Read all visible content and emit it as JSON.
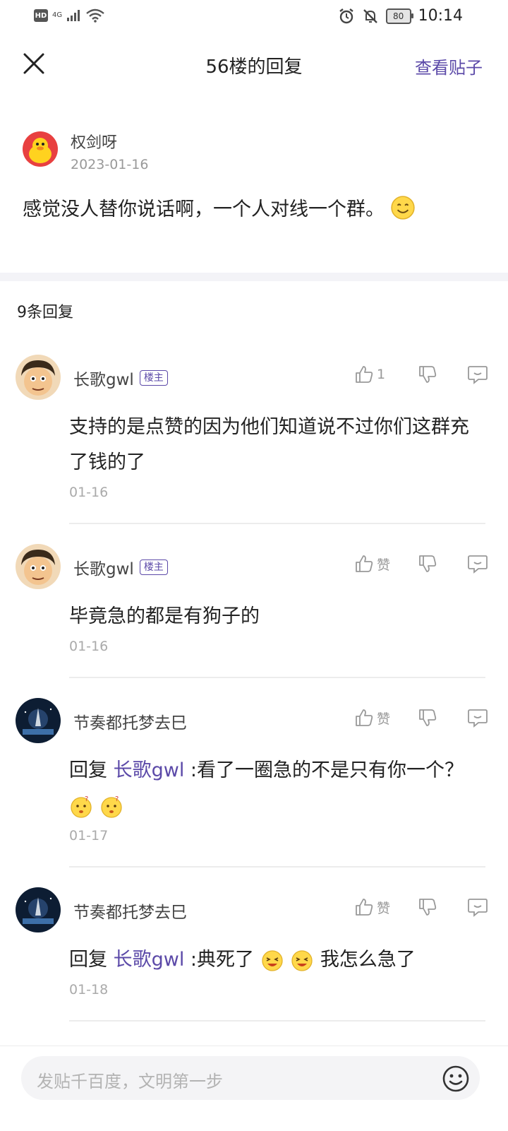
{
  "status_bar": {
    "hd": "HD",
    "network": "4G",
    "battery": "80",
    "time": "10:14"
  },
  "header": {
    "title": "56楼的回复",
    "view_post": "查看贴子"
  },
  "post": {
    "author": "权剑呀",
    "date": "2023-01-16",
    "text": "感觉没人替你说话啊，一个人对线一个群。"
  },
  "replies_header": "9条回复",
  "replies": [
    {
      "name": "长歌gwl",
      "badge": "楼主",
      "like": "1",
      "text": "支持的是点赞的因为他们知道说不过你们这群充了钱的了",
      "date": "01-16"
    },
    {
      "name": "长歌gwl",
      "badge": "楼主",
      "like": "赞",
      "text": "毕竟急的都是有狗子的",
      "date": "01-16"
    },
    {
      "name": "节奏都托梦去巳",
      "like": "赞",
      "reply_prefix": "回复",
      "mention": "长歌gwl",
      "text": " :看了一圈急的不是只有你一个？",
      "date": "01-17"
    },
    {
      "name": "节奏都托梦去巳",
      "like": "赞",
      "reply_prefix": "回复",
      "mention": "长歌gwl",
      "text_a": " :典死了",
      "text_b": "我怎么急了",
      "date": "01-18"
    }
  ],
  "input": {
    "placeholder": "发贴千百度，文明第一步"
  },
  "colors": {
    "accent": "#5b49a8",
    "muted": "#999999",
    "band": "#f3f3f7"
  }
}
